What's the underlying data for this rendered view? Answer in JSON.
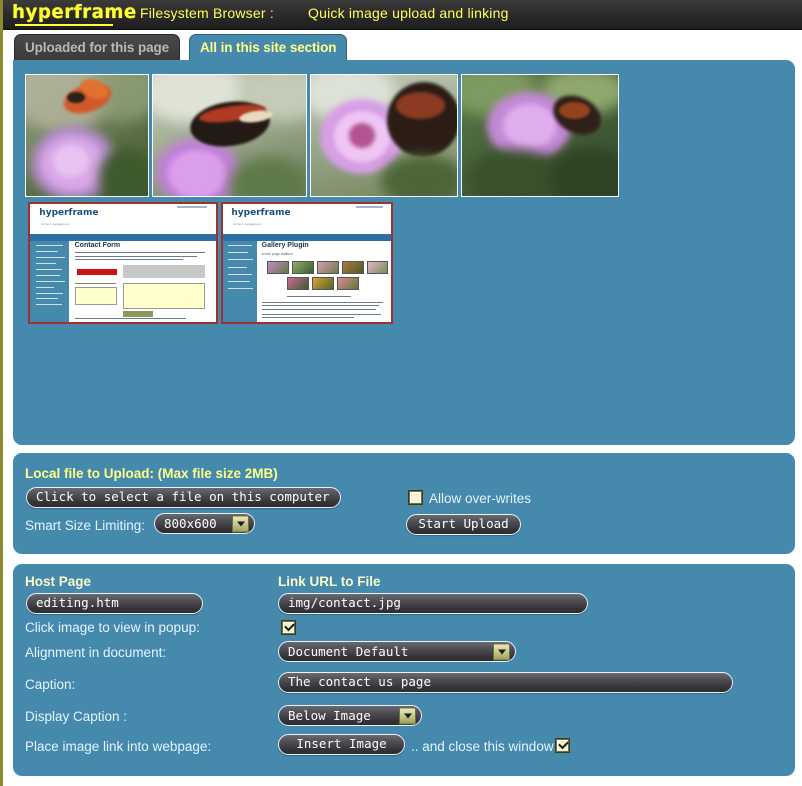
{
  "header": {
    "logo": "hyperframe",
    "title": "Filesystem Browser :",
    "subtitle": "Quick image upload and linking"
  },
  "tabs": [
    {
      "label": "Uploaded for this page",
      "active": false
    },
    {
      "label": "All in this site section",
      "active": true
    }
  ],
  "gallery": {
    "photos": [
      {
        "name": "butterfly-on-buddleia-1",
        "kind": "photo"
      },
      {
        "name": "butterfly-on-buddleia-2",
        "kind": "photo"
      },
      {
        "name": "butterfly-on-buddleia-3",
        "kind": "photo"
      },
      {
        "name": "butterfly-on-buddleia-4",
        "kind": "photo"
      }
    ],
    "screenshots": [
      {
        "name": "contact-form-screenshot",
        "heading": "Contact Form",
        "logo": "hyperframe"
      },
      {
        "name": "gallery-plugin-screenshot",
        "heading": "Gallery Plugin",
        "subheading": "a web page addition",
        "logo": "hyperframe"
      }
    ]
  },
  "upload": {
    "section_label": "Local file to Upload: (Max file size 2MB)",
    "file_button": "Click to select a file on this computer",
    "size_limit_label": "Smart Size Limiting:",
    "size_limit_value": "800x600",
    "size_limit_options": [
      "800x600"
    ],
    "overwrite_label": "Allow over-writes",
    "overwrite_checked": false,
    "start_button": "Start Upload"
  },
  "link": {
    "host_page_label": "Host Page",
    "host_page_value": "editing.htm",
    "link_url_label": "Link URL to File",
    "link_url_value": "img/contact.jpg",
    "popup_label": "Click image to view in popup:",
    "popup_checked": true,
    "alignment_label": "Alignment in document:",
    "alignment_value": "Document Default",
    "alignment_options": [
      "Document Default"
    ],
    "caption_label": "Caption:",
    "caption_value": "The contact us page",
    "display_caption_label": "Display Caption :",
    "display_caption_value": "Below Image",
    "display_caption_options": [
      "Below Image"
    ],
    "place_label": "Place image link into webpage:",
    "insert_button": "Insert Image",
    "close_window_label": ".. and close this window",
    "close_window_checked": true
  },
  "colors": {
    "panel": "#4589ad",
    "header_bg": "#2c2c2c",
    "accent_yellow": "#ffff55",
    "tab_active_text": "#ffff88",
    "page_border": "#8a8a2e"
  }
}
